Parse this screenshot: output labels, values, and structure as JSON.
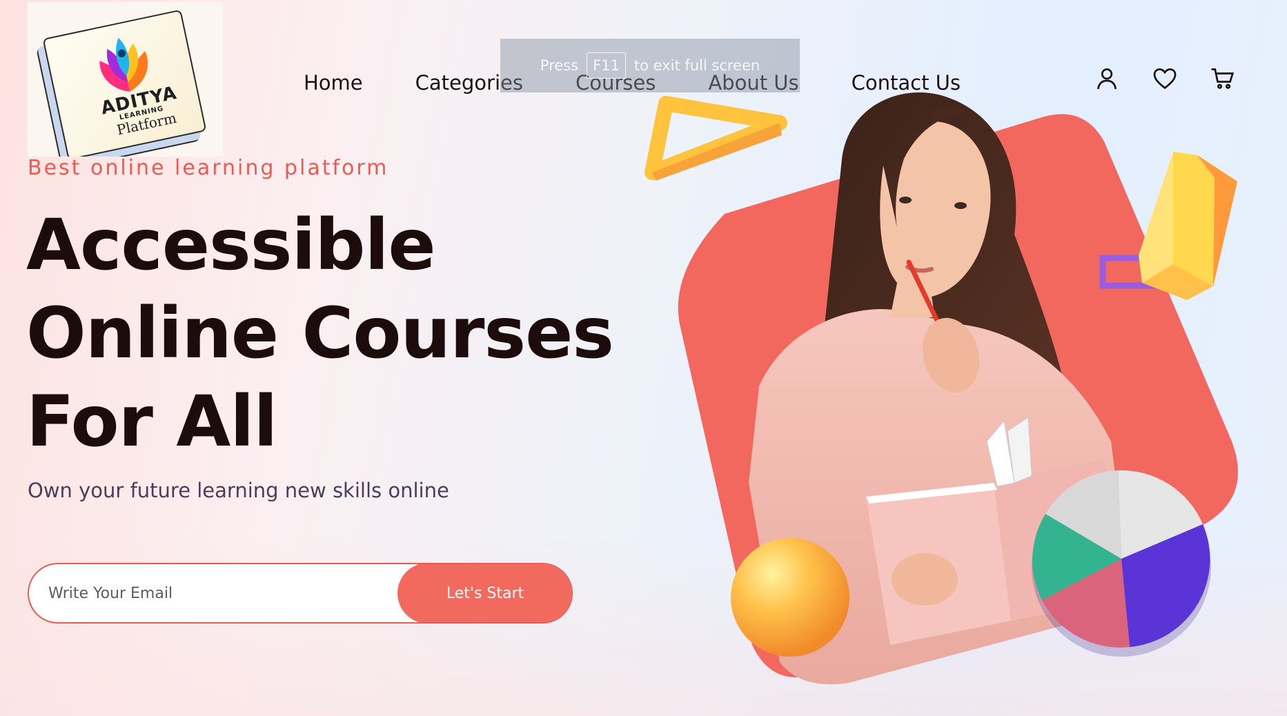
{
  "logo": {
    "brand_top": "ADITYA",
    "brand_mid": "LEARNING",
    "brand_bottom": "Platform"
  },
  "nav": {
    "items": [
      {
        "label": "Home"
      },
      {
        "label": "Categories"
      },
      {
        "label": "Courses"
      },
      {
        "label": "About Us"
      },
      {
        "label": "Contact Us"
      }
    ],
    "icons": [
      "user-icon",
      "heart-icon",
      "cart-icon"
    ]
  },
  "overlay": {
    "press": "Press",
    "key": "F11",
    "message": "to exit full screen"
  },
  "hero": {
    "tagline": "Best online learning platform",
    "headline_lines": [
      "Accessible",
      "Online Courses",
      "For All"
    ],
    "subtitle": "Own your future learning new skills online"
  },
  "form": {
    "email_placeholder": "Write Your Email",
    "email_value": "",
    "submit_label": "Let's Start"
  },
  "colors": {
    "accent": "#ec5b52",
    "button": "#f26a5e",
    "heading": "#1c0c0c",
    "subtitle": "#4a3e58",
    "shape_coral": "#f2675e",
    "shape_yellow": "#ffc14a",
    "shape_purple": "#5a34d6",
    "shape_teal": "#33b38f"
  }
}
